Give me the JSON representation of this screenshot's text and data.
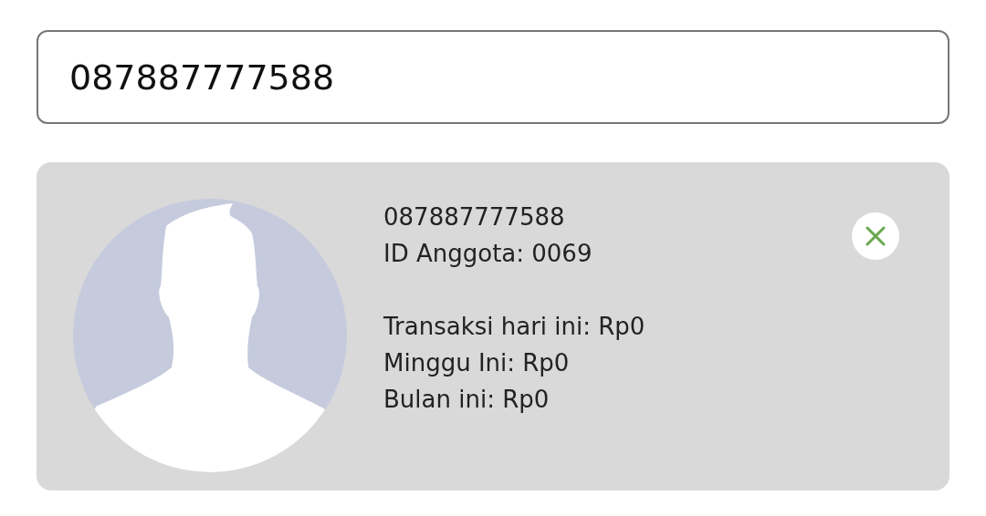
{
  "search": {
    "value": "087887777588"
  },
  "member": {
    "phone": "087887777588",
    "member_id": "ID Anggota: 0069",
    "stats": [
      "Transaksi hari ini: Rp0",
      "Minggu Ini: Rp0",
      "Bulan ini: Rp0"
    ]
  }
}
